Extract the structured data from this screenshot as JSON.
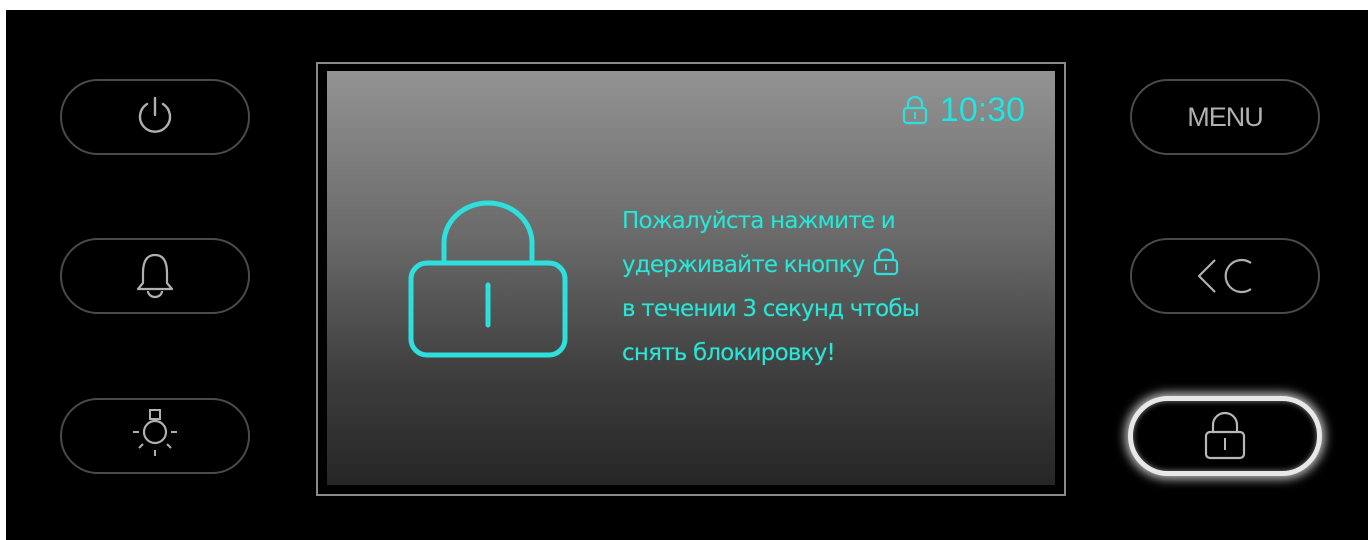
{
  "buttons": {
    "left": [
      {
        "name": "power-button",
        "icon": "power-icon"
      },
      {
        "name": "alarm-button",
        "icon": "bell-icon"
      },
      {
        "name": "light-button",
        "icon": "lamp-icon"
      }
    ],
    "right": [
      {
        "name": "menu-button",
        "label": "MENU"
      },
      {
        "name": "back-button",
        "icon": "back-arrow-icon"
      },
      {
        "name": "lock-button",
        "icon": "lock-icon",
        "active": true
      }
    ]
  },
  "screen": {
    "status_icon": "lock-icon",
    "time": "10:30",
    "big_icon": "lock-icon",
    "message": {
      "line1": "Пожалуйста нажмите и",
      "line2": "удерживайте кнопку",
      "line2_icon": "lock-icon",
      "line3": "в течении 3 секунд чтобы",
      "line4": "снять блокировку!"
    }
  },
  "colors": {
    "accent": "#2ee0dd",
    "panel": "#000000",
    "button_border": "#4a4a4a",
    "icon_gray": "#b0b0b0"
  }
}
